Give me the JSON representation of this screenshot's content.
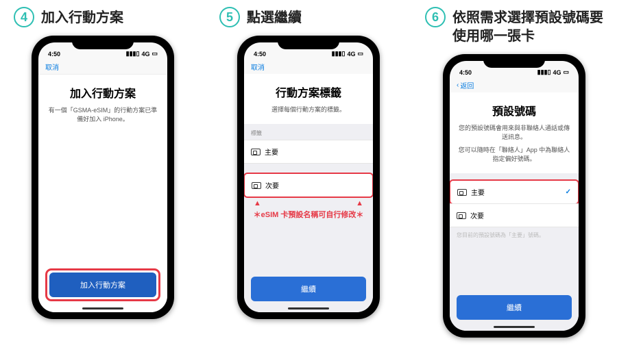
{
  "steps": [
    {
      "num": "4",
      "title": "加入行動方案"
    },
    {
      "num": "5",
      "title": "點選繼續"
    },
    {
      "num": "6",
      "title": "依照需求選擇預設號碼要使用哪一張卡"
    }
  ],
  "statusTime": "4:50",
  "statusNet": "4G",
  "nav": {
    "cancel": "取消",
    "back": "返回"
  },
  "screen4": {
    "title": "加入行動方案",
    "desc": "有一個「GSMA-eSIM」的行動方案已準備好加入 iPhone。",
    "button": "加入行動方案"
  },
  "screen5": {
    "title": "行動方案標籤",
    "desc": "選擇每個行動方案的標籤。",
    "section": "標籤",
    "row1": "主要",
    "row2": "次要",
    "warn": "＊eSIM 卡預設名稱可自行修改＊",
    "button": "繼續"
  },
  "screen6": {
    "title": "預設號碼",
    "desc1": "您的預設號碼會用來與非聯絡人通話或傳送訊息。",
    "desc2": "您可以隨時在「聯絡人」App 中為聯絡人指定偏好號碼。",
    "row1": "主要",
    "row2": "次要",
    "hint": "您目前的預設號碼為「主要」號碼。",
    "button": "繼續"
  }
}
